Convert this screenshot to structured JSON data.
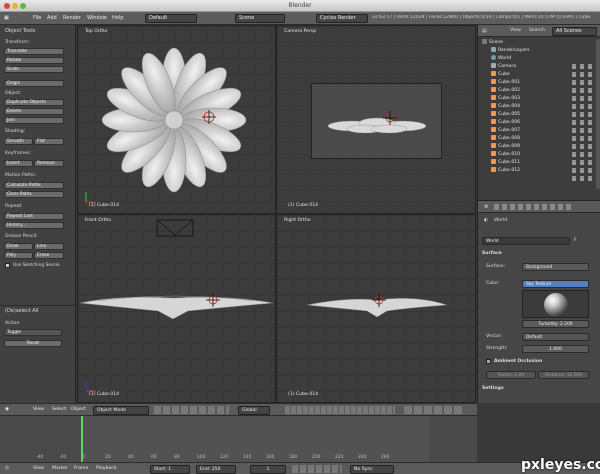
{
  "window": {
    "title": "Blender"
  },
  "menu": {
    "items": [
      "File",
      "Add",
      "Render",
      "Window",
      "Help"
    ],
    "layout": "Default",
    "scene": "Scene",
    "engine": "Cycles Render",
    "stats": "v2.63.17 | Verts:12024 | Faces:12800 | Objects:0/19 | Lamps:0/1 | Mem:10.57M (0.16M) | Cube"
  },
  "tools": {
    "header": "Object Tools",
    "transform_label": "Transform:",
    "transform": [
      "Translate",
      "Rotate",
      "Scale"
    ],
    "origin": "Origin",
    "object_label": "Object:",
    "object": [
      "Duplicate Objects",
      "Delete",
      "Join"
    ],
    "shading_label": "Shading:",
    "shading": [
      "Smooth",
      "Flat"
    ],
    "keyframes_label": "Keyframes:",
    "keyframes": [
      "Insert",
      "Remove"
    ],
    "motion_label": "Motion Paths:",
    "motion": [
      "Calculate Paths",
      "Clear Paths"
    ],
    "repeat_label": "Repeat:",
    "repeat": [
      "Repeat Last",
      "History..."
    ],
    "grease_label": "Grease Pencil:",
    "grease": [
      "Draw",
      "Line",
      "Poly",
      "Erase"
    ],
    "sketch": "Use Sketching Sessio",
    "deselect": "(De)select All",
    "action_label": "Action",
    "action_value": "Toggle",
    "reset": "Reset"
  },
  "viewports": {
    "top": {
      "label": "Top Ortho",
      "footer": "(1) Cube.014"
    },
    "camera": {
      "label": "Camera Persp",
      "footer": "(1) Cube.014"
    },
    "front": {
      "label": "Front Ortho",
      "footer": "(1) Cube.014"
    },
    "right": {
      "label": "Right Ortho",
      "footer": "(1) Cube.014"
    }
  },
  "outliner": {
    "view": "View",
    "search": "Search",
    "scenes": "All Scenes",
    "items": [
      "Scene",
      "RenderLayers",
      "World",
      "Camera",
      "Cube",
      "Cube.001",
      "Cube.002",
      "Cube.003",
      "Cube.004",
      "Cube.005",
      "Cube.006",
      "Cube.007",
      "Cube.008",
      "Cube.009",
      "Cube.010",
      "Cube.011",
      "Cube.012"
    ]
  },
  "properties": {
    "breadcrumb": "World",
    "world_field": "World",
    "surface_header": "Surface",
    "surface_label": "Surface:",
    "surface_value": "Background",
    "color_label": "Color:",
    "color_value": "Sky Texture",
    "turbidity": "Turbidity: 2.200",
    "vector_label": "Vector:",
    "vector_value": "Default",
    "strength_label": "Strength:",
    "strength_value": "1.000",
    "ambient_header": "Ambient Occlusion",
    "factor": "Factor: 1.00",
    "distance": "Distance: 10.000",
    "settings_header": "Settings"
  },
  "view3d_header": {
    "items": [
      "View",
      "Select",
      "Object"
    ],
    "mode": "Object Mode",
    "orientation": "Global"
  },
  "timeline": {
    "ticks": [
      "-40",
      "-20",
      "0",
      "20",
      "40",
      "60",
      "80",
      "100",
      "120",
      "140",
      "160",
      "180",
      "200",
      "220",
      "240",
      "260"
    ],
    "current_frame": 1
  },
  "timeline_header": {
    "items": [
      "View",
      "Marker",
      "Frame",
      "Playback"
    ],
    "start": "Start: 1",
    "end": "End: 250",
    "frame": "1",
    "sync": "No Sync"
  },
  "watermark": "pxleyes.com"
}
